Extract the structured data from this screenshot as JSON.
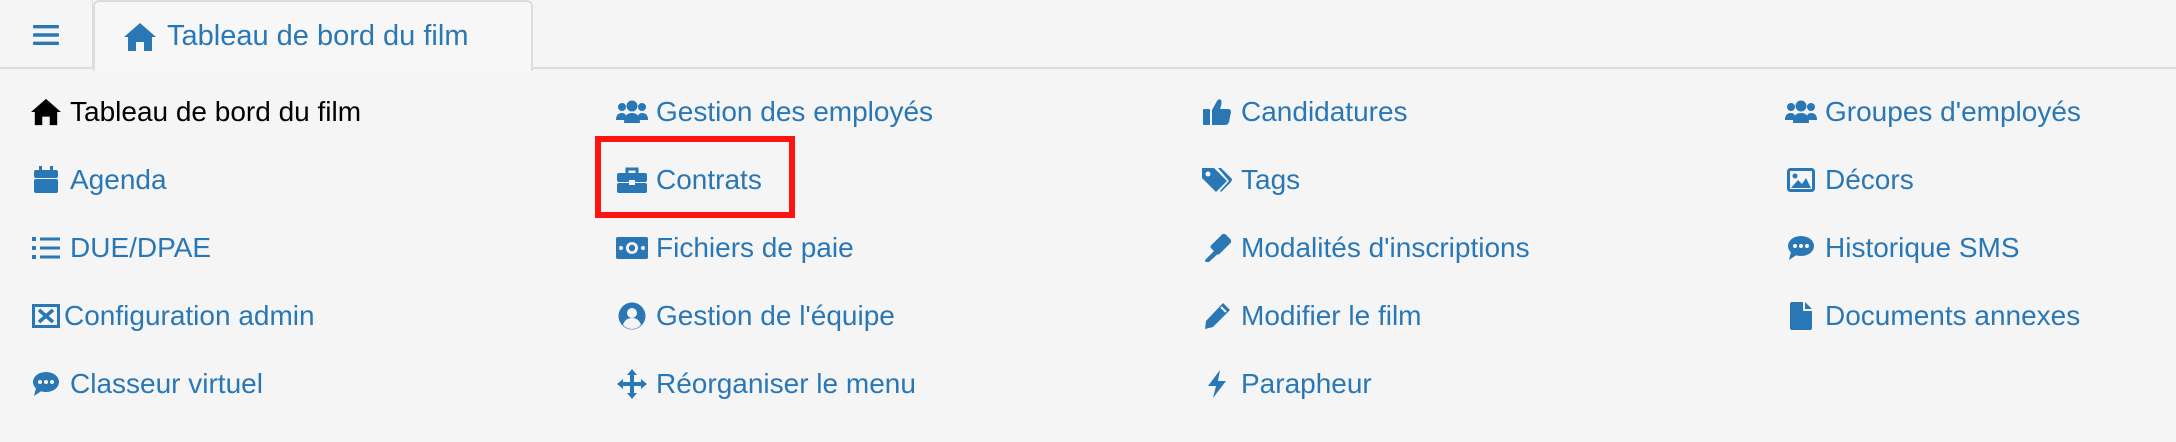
{
  "header": {
    "tab_label": "Tableau de bord du film"
  },
  "menu": {
    "col1": [
      {
        "label": "Tableau de bord du film",
        "icon": "home-icon"
      },
      {
        "label": "Agenda",
        "icon": "calendar-icon"
      },
      {
        "label": "DUE/DPAE",
        "icon": "list-icon"
      },
      {
        "label": "Configuration admin",
        "icon": "admin-box-icon"
      },
      {
        "label": "Classeur virtuel",
        "icon": "comment-dots-icon"
      }
    ],
    "col2": [
      {
        "label": "Gestion des employés",
        "icon": "users-icon"
      },
      {
        "label": "Contrats",
        "icon": "briefcase-icon"
      },
      {
        "label": "Fichiers de paie",
        "icon": "money-bill-icon"
      },
      {
        "label": "Gestion de l'équipe",
        "icon": "user-circle-icon"
      },
      {
        "label": "Réorganiser le menu",
        "icon": "arrows-move-icon"
      }
    ],
    "col3": [
      {
        "label": "Candidatures",
        "icon": "thumbs-up-icon"
      },
      {
        "label": "Tags",
        "icon": "tags-icon"
      },
      {
        "label": "Modalités d'inscriptions",
        "icon": "gavel-icon"
      },
      {
        "label": "Modifier le film",
        "icon": "pencil-icon"
      },
      {
        "label": "Parapheur",
        "icon": "bolt-icon"
      }
    ],
    "col4": [
      {
        "label": "Groupes d'employés",
        "icon": "users-icon"
      },
      {
        "label": "Décors",
        "icon": "image-icon"
      },
      {
        "label": "Historique SMS",
        "icon": "comment-dots-icon"
      },
      {
        "label": "Documents annexes",
        "icon": "file-icon"
      }
    ]
  },
  "colors": {
    "link": "#2a77b6",
    "active": "#000000",
    "highlight": "#ff1414"
  }
}
